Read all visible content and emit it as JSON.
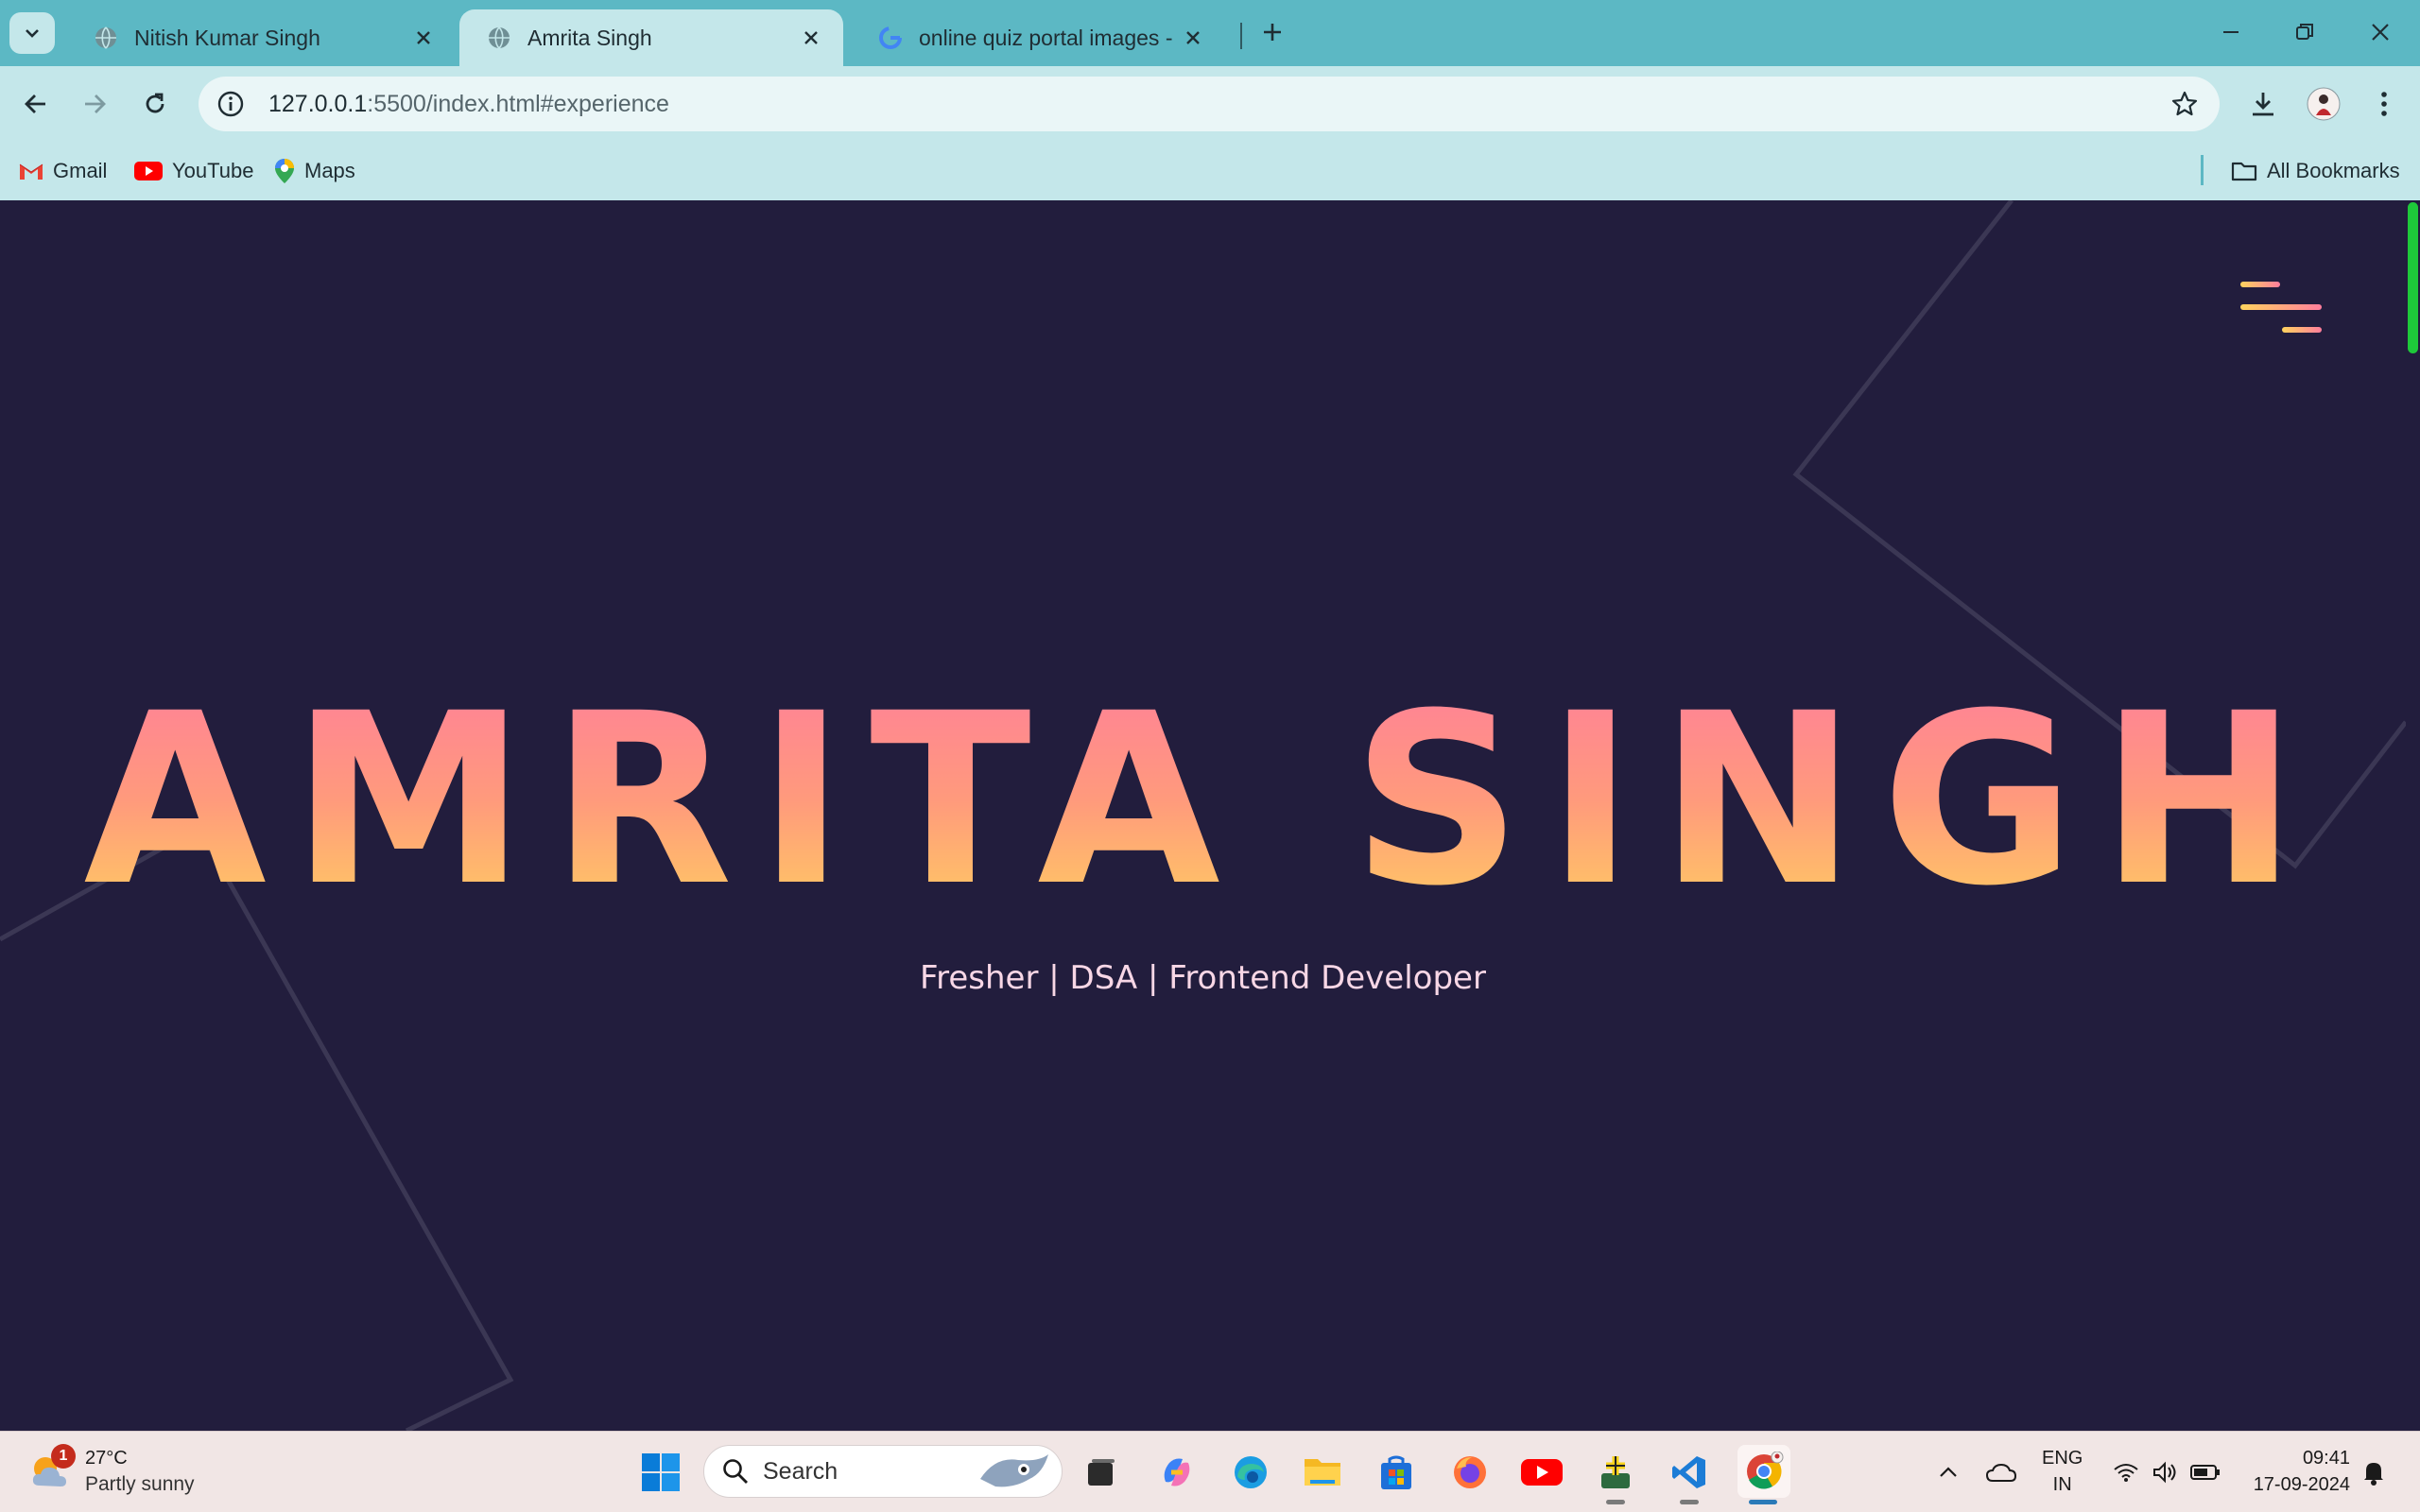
{
  "browser": {
    "tabs": [
      {
        "title": "Nitish Kumar Singh",
        "active": false
      },
      {
        "title": "Amrita Singh",
        "active": true
      },
      {
        "title": "online quiz portal images - Goo",
        "active": false
      }
    ],
    "url_host": "127.0.0.1",
    "url_rest": ":5500/index.html#experience",
    "bookmarks": [
      {
        "label": "Gmail",
        "icon": "gmail-icon"
      },
      {
        "label": "YouTube",
        "icon": "youtube-icon"
      },
      {
        "label": "Maps",
        "icon": "maps-icon"
      }
    ],
    "all_bookmarks": "All Bookmarks"
  },
  "page": {
    "name": "AMRITA SINGH",
    "subtitle": "Fresher | DSA | Frontend Developer",
    "colors": {
      "background": "#221d3d",
      "gradient_top": "#ff7d9c",
      "gradient_bottom": "#ffd45e",
      "subtitle": "#f8d7e6",
      "scroll_thumb": "#1ec93a"
    }
  },
  "taskbar": {
    "weather": {
      "temp": "27°C",
      "condition": "Partly sunny",
      "badge": "1"
    },
    "search_label": "Search",
    "lang_top": "ENG",
    "lang_bottom": "IN",
    "time": "09:41",
    "date": "17-09-2024"
  }
}
